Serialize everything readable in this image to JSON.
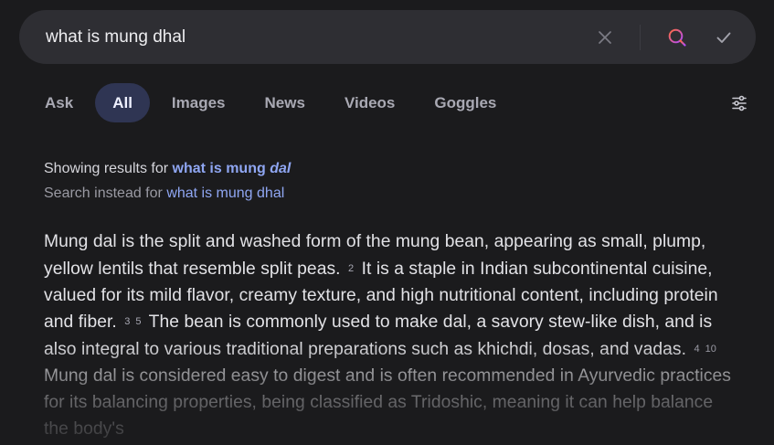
{
  "search": {
    "query": "what is mung dhal",
    "icons": {
      "clear": "close-icon",
      "search": "search-icon",
      "submit": "check-icon"
    },
    "colors": {
      "search_icon_gradient_start": "#ff6a3d",
      "search_icon_gradient_end": "#b04bff"
    }
  },
  "tabs": [
    {
      "label": "Ask"
    },
    {
      "label": "All",
      "active": true
    },
    {
      "label": "Images"
    },
    {
      "label": "News"
    },
    {
      "label": "Videos"
    },
    {
      "label": "Goggles"
    }
  ],
  "settings_icon": "sliders-icon",
  "spell_correction": {
    "showing_prefix": "Showing results for",
    "corrected_query_plain": "what is mung ",
    "corrected_query_emph": "dal",
    "instead_prefix": "Search instead for",
    "original_query": "what is mung dhal"
  },
  "answer": {
    "segments": [
      {
        "text": "Mung dal is the split and washed form of the mung bean, appearing as small, plump, yellow lentils that resemble split peas.",
        "citations": [
          "2"
        ]
      },
      {
        "text": "It is a staple in Indian subcontinental cuisine, valued for its mild flavor, creamy texture, and high nutritional content, including protein and fiber.",
        "citations": [
          "3",
          "5"
        ]
      },
      {
        "text": "The bean is commonly used to make dal, a savory stew-like dish, and is also integral to various traditional preparations such as khichdi, dosas, and vadas.",
        "citations": [
          "4",
          "10"
        ]
      },
      {
        "text": "Mung dal is considered easy to digest and is often recommended in Ayurvedic practices for its balancing properties, being classified as Tridoshic, meaning it can help balance the body's",
        "citations": []
      }
    ]
  },
  "colors": {
    "background": "#1b1b1d",
    "search_bar": "#2e2e33",
    "active_tab_bg": "#2f3553",
    "link": "#8fa6f2"
  }
}
